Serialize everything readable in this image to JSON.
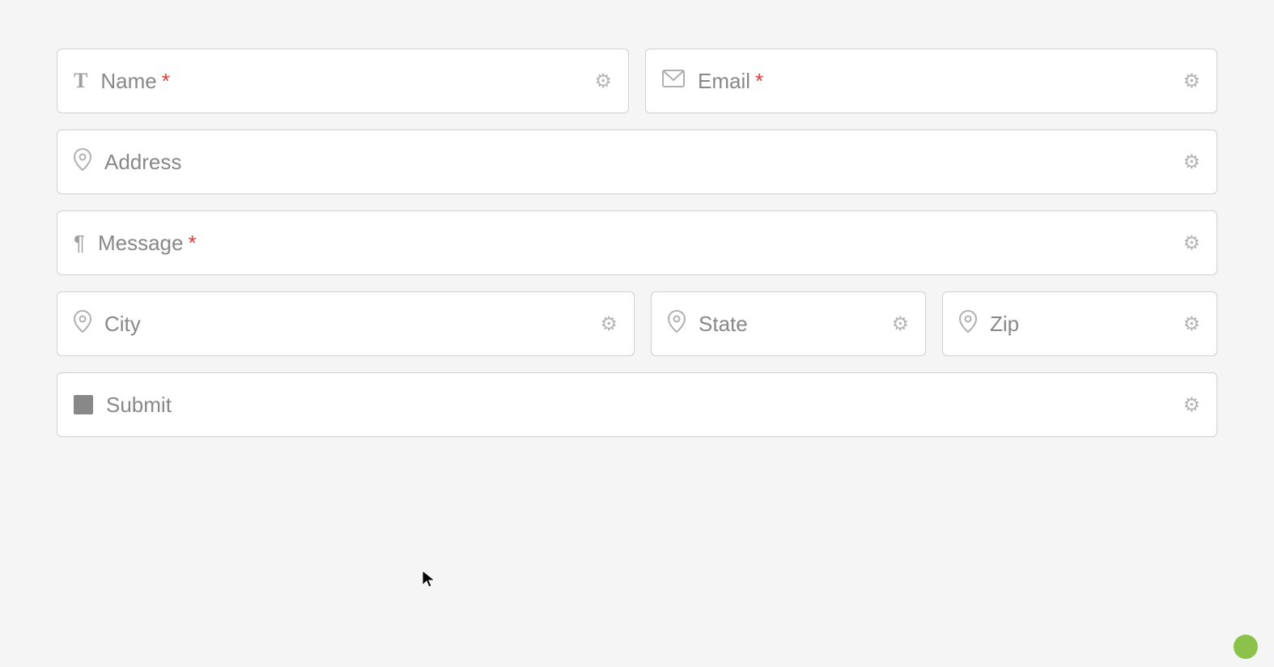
{
  "form": {
    "fields": {
      "name": {
        "label": "Name",
        "required": true,
        "icon": "text-icon",
        "gear_label": "⚙"
      },
      "email": {
        "label": "Email",
        "required": true,
        "icon": "email-icon",
        "gear_label": "⚙"
      },
      "address": {
        "label": "Address",
        "required": false,
        "icon": "location-icon",
        "gear_label": "⚙"
      },
      "message": {
        "label": "Message",
        "required": true,
        "icon": "paragraph-icon",
        "gear_label": "⚙"
      },
      "city": {
        "label": "City",
        "required": false,
        "icon": "location-icon",
        "gear_label": "⚙"
      },
      "state": {
        "label": "State",
        "required": false,
        "icon": "location-icon",
        "gear_label": "⚙"
      },
      "zip": {
        "label": "Zip",
        "required": false,
        "icon": "location-icon",
        "gear_label": "⚙"
      },
      "submit": {
        "label": "Submit",
        "required": false,
        "icon": "button-icon",
        "gear_label": "⚙"
      }
    },
    "required_marker": "*"
  }
}
